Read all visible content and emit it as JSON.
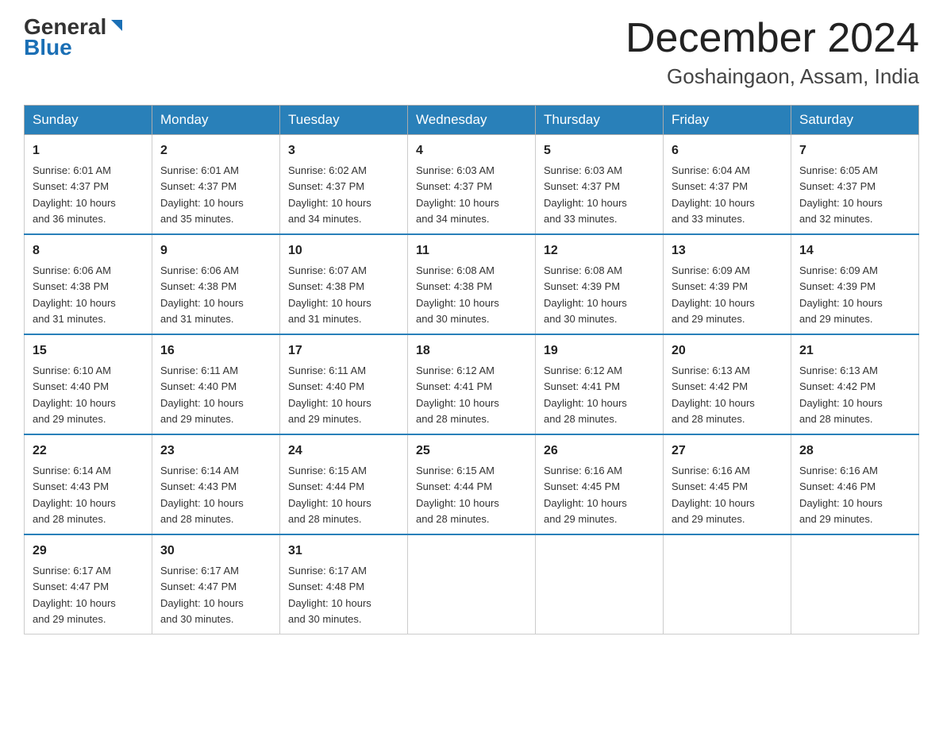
{
  "logo": {
    "text1": "General",
    "text2": "Blue"
  },
  "header": {
    "month": "December 2024",
    "location": "Goshaingaon, Assam, India"
  },
  "weekdays": [
    "Sunday",
    "Monday",
    "Tuesday",
    "Wednesday",
    "Thursday",
    "Friday",
    "Saturday"
  ],
  "weeks": [
    [
      {
        "day": "1",
        "sunrise": "6:01 AM",
        "sunset": "4:37 PM",
        "daylight": "10 hours and 36 minutes."
      },
      {
        "day": "2",
        "sunrise": "6:01 AM",
        "sunset": "4:37 PM",
        "daylight": "10 hours and 35 minutes."
      },
      {
        "day": "3",
        "sunrise": "6:02 AM",
        "sunset": "4:37 PM",
        "daylight": "10 hours and 34 minutes."
      },
      {
        "day": "4",
        "sunrise": "6:03 AM",
        "sunset": "4:37 PM",
        "daylight": "10 hours and 34 minutes."
      },
      {
        "day": "5",
        "sunrise": "6:03 AM",
        "sunset": "4:37 PM",
        "daylight": "10 hours and 33 minutes."
      },
      {
        "day": "6",
        "sunrise": "6:04 AM",
        "sunset": "4:37 PM",
        "daylight": "10 hours and 33 minutes."
      },
      {
        "day": "7",
        "sunrise": "6:05 AM",
        "sunset": "4:37 PM",
        "daylight": "10 hours and 32 minutes."
      }
    ],
    [
      {
        "day": "8",
        "sunrise": "6:06 AM",
        "sunset": "4:38 PM",
        "daylight": "10 hours and 31 minutes."
      },
      {
        "day": "9",
        "sunrise": "6:06 AM",
        "sunset": "4:38 PM",
        "daylight": "10 hours and 31 minutes."
      },
      {
        "day": "10",
        "sunrise": "6:07 AM",
        "sunset": "4:38 PM",
        "daylight": "10 hours and 31 minutes."
      },
      {
        "day": "11",
        "sunrise": "6:08 AM",
        "sunset": "4:38 PM",
        "daylight": "10 hours and 30 minutes."
      },
      {
        "day": "12",
        "sunrise": "6:08 AM",
        "sunset": "4:39 PM",
        "daylight": "10 hours and 30 minutes."
      },
      {
        "day": "13",
        "sunrise": "6:09 AM",
        "sunset": "4:39 PM",
        "daylight": "10 hours and 29 minutes."
      },
      {
        "day": "14",
        "sunrise": "6:09 AM",
        "sunset": "4:39 PM",
        "daylight": "10 hours and 29 minutes."
      }
    ],
    [
      {
        "day": "15",
        "sunrise": "6:10 AM",
        "sunset": "4:40 PM",
        "daylight": "10 hours and 29 minutes."
      },
      {
        "day": "16",
        "sunrise": "6:11 AM",
        "sunset": "4:40 PM",
        "daylight": "10 hours and 29 minutes."
      },
      {
        "day": "17",
        "sunrise": "6:11 AM",
        "sunset": "4:40 PM",
        "daylight": "10 hours and 29 minutes."
      },
      {
        "day": "18",
        "sunrise": "6:12 AM",
        "sunset": "4:41 PM",
        "daylight": "10 hours and 28 minutes."
      },
      {
        "day": "19",
        "sunrise": "6:12 AM",
        "sunset": "4:41 PM",
        "daylight": "10 hours and 28 minutes."
      },
      {
        "day": "20",
        "sunrise": "6:13 AM",
        "sunset": "4:42 PM",
        "daylight": "10 hours and 28 minutes."
      },
      {
        "day": "21",
        "sunrise": "6:13 AM",
        "sunset": "4:42 PM",
        "daylight": "10 hours and 28 minutes."
      }
    ],
    [
      {
        "day": "22",
        "sunrise": "6:14 AM",
        "sunset": "4:43 PM",
        "daylight": "10 hours and 28 minutes."
      },
      {
        "day": "23",
        "sunrise": "6:14 AM",
        "sunset": "4:43 PM",
        "daylight": "10 hours and 28 minutes."
      },
      {
        "day": "24",
        "sunrise": "6:15 AM",
        "sunset": "4:44 PM",
        "daylight": "10 hours and 28 minutes."
      },
      {
        "day": "25",
        "sunrise": "6:15 AM",
        "sunset": "4:44 PM",
        "daylight": "10 hours and 28 minutes."
      },
      {
        "day": "26",
        "sunrise": "6:16 AM",
        "sunset": "4:45 PM",
        "daylight": "10 hours and 29 minutes."
      },
      {
        "day": "27",
        "sunrise": "6:16 AM",
        "sunset": "4:45 PM",
        "daylight": "10 hours and 29 minutes."
      },
      {
        "day": "28",
        "sunrise": "6:16 AM",
        "sunset": "4:46 PM",
        "daylight": "10 hours and 29 minutes."
      }
    ],
    [
      {
        "day": "29",
        "sunrise": "6:17 AM",
        "sunset": "4:47 PM",
        "daylight": "10 hours and 29 minutes."
      },
      {
        "day": "30",
        "sunrise": "6:17 AM",
        "sunset": "4:47 PM",
        "daylight": "10 hours and 30 minutes."
      },
      {
        "day": "31",
        "sunrise": "6:17 AM",
        "sunset": "4:48 PM",
        "daylight": "10 hours and 30 minutes."
      },
      null,
      null,
      null,
      null
    ]
  ],
  "labels": {
    "sunrise_prefix": "Sunrise: ",
    "sunset_prefix": "Sunset: ",
    "daylight_prefix": "Daylight: "
  }
}
